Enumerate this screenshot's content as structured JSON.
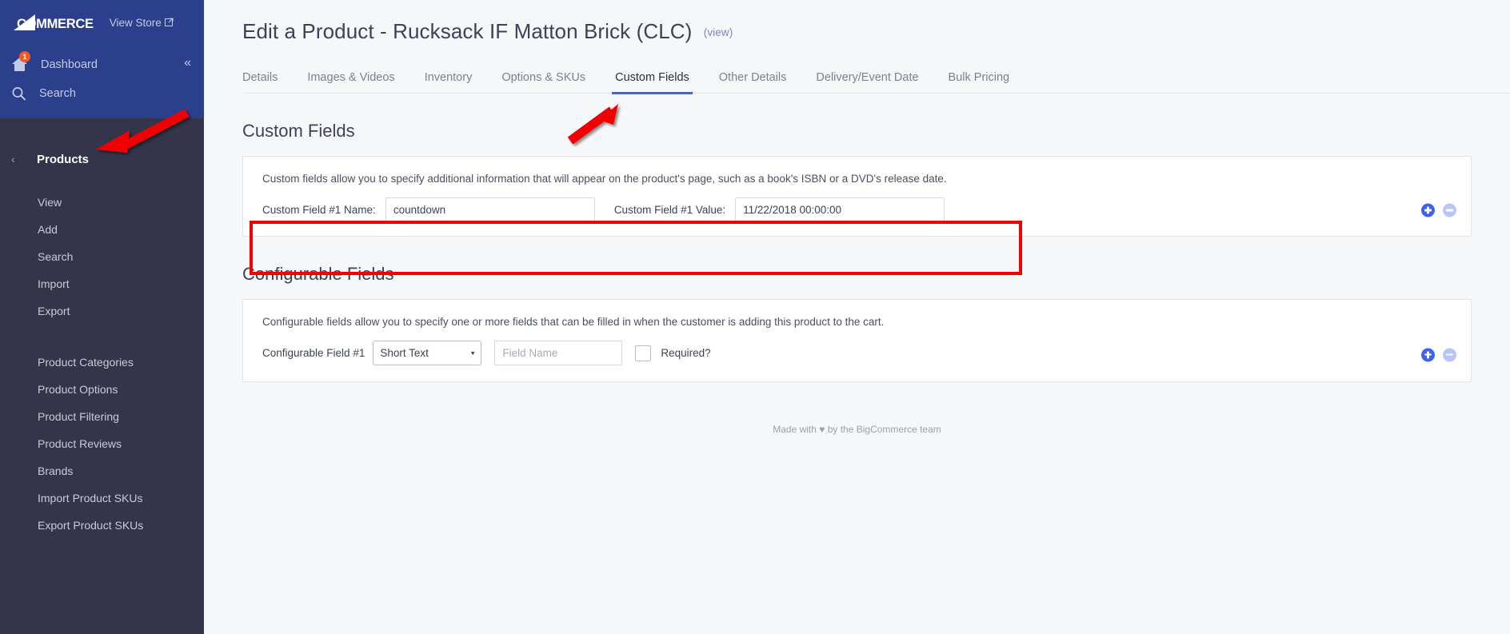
{
  "sidebar": {
    "brand": {
      "logo_text": "COMMERCE",
      "logo_mark": "BIG",
      "view_store": "View Store",
      "view_store_icon": "external-link-icon"
    },
    "dashboard": {
      "label": "Dashboard",
      "badge": "1",
      "icon": "home-icon"
    },
    "collapse_icon": "«",
    "search": {
      "label": "Search",
      "icon": "search-icon"
    },
    "section": {
      "label": "Products",
      "back_caret": "‹"
    },
    "items_primary": [
      {
        "label": "View"
      },
      {
        "label": "Add"
      },
      {
        "label": "Search"
      },
      {
        "label": "Import"
      },
      {
        "label": "Export"
      }
    ],
    "items_secondary": [
      {
        "label": "Product Categories"
      },
      {
        "label": "Product Options"
      },
      {
        "label": "Product Filtering"
      },
      {
        "label": "Product Reviews"
      },
      {
        "label": "Brands"
      },
      {
        "label": "Import Product SKUs"
      },
      {
        "label": "Export Product SKUs"
      }
    ]
  },
  "header": {
    "title": "Edit a Product - Rucksack IF Matton Brick (CLC)",
    "view_link": "(view)"
  },
  "tabs": [
    {
      "label": "Details",
      "active": false
    },
    {
      "label": "Images & Videos",
      "active": false
    },
    {
      "label": "Inventory",
      "active": false
    },
    {
      "label": "Options & SKUs",
      "active": false
    },
    {
      "label": "Custom Fields",
      "active": true
    },
    {
      "label": "Other Details",
      "active": false
    },
    {
      "label": "Delivery/Event Date",
      "active": false
    },
    {
      "label": "Bulk Pricing",
      "active": false
    }
  ],
  "custom_fields": {
    "section_title": "Custom Fields",
    "description": "Custom fields allow you to specify additional information that will appear on the product's page, such as a book's ISBN or a DVD's release date.",
    "rows": [
      {
        "name_label": "Custom Field #1 Name:",
        "name_value": "countdown",
        "value_label": "Custom Field #1 Value:",
        "value_value": "11/22/2018 00:00:00",
        "add_icon": "plus-circle-icon",
        "remove_icon": "minus-circle-icon"
      }
    ]
  },
  "configurable_fields": {
    "section_title": "Configurable Fields",
    "description": "Configurable fields allow you to specify one or more fields that can be filled in when the customer is adding this product to the cart.",
    "rows": [
      {
        "label": "Configurable Field #1",
        "type_selected": "Short Text",
        "type_caret": "▾",
        "field_name_placeholder": "Field Name",
        "field_name_value": "",
        "required_label": "Required?",
        "add_icon": "plus-circle-icon",
        "remove_icon": "minus-circle-icon"
      }
    ]
  },
  "footer": {
    "prefix": "Made with ",
    "heart": "♥",
    "suffix": " by the BigCommerce team"
  },
  "colors": {
    "sidebar_top": "#2b3f8c",
    "sidebar_body": "#34344a",
    "accent_blue": "#3c64f4",
    "annotation_red": "#f00000",
    "badge_orange": "#ef5a24"
  }
}
